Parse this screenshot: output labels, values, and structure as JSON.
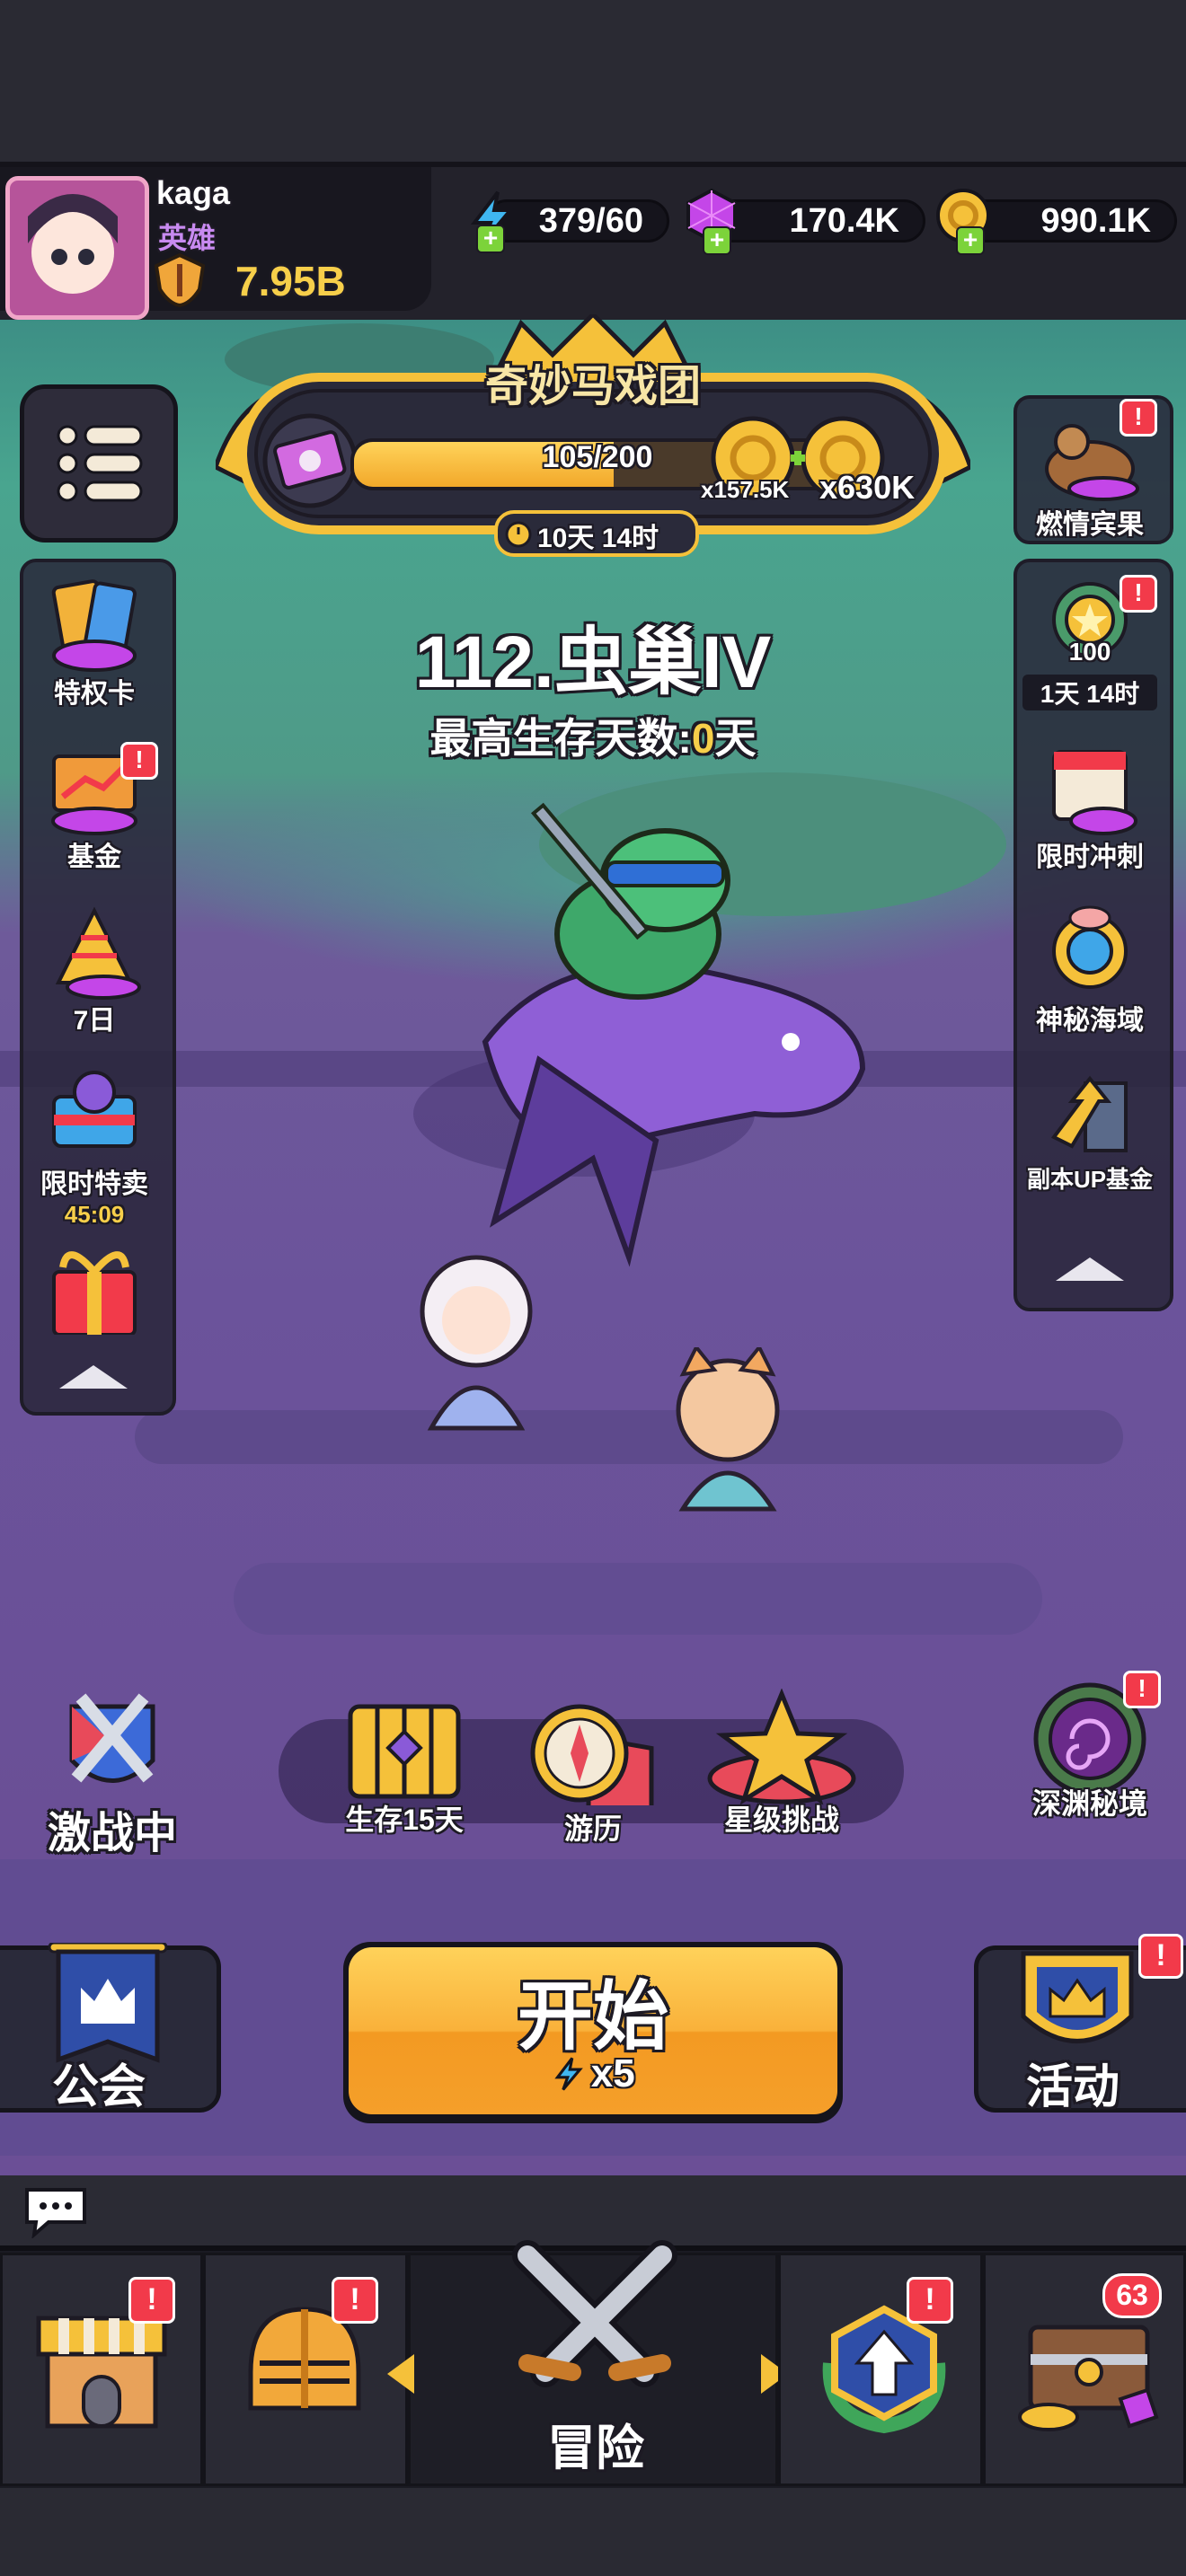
{
  "player": {
    "name": "kaga",
    "title": "英雄",
    "power": "7.95B"
  },
  "resources": {
    "energy": "379/60",
    "gems": "170.4K",
    "coins": "990.1K"
  },
  "event_banner": {
    "title": "奇妙马戏团",
    "progress_text": "105/200",
    "progress_fraction": 0.525,
    "reward_small": "x157.5K",
    "reward_large": "x630K",
    "timer": "10天 14时"
  },
  "stage": {
    "title": "112.虫巢IV",
    "subtitle_prefix": "最高生存天数:",
    "subtitle_value": "0",
    "subtitle_suffix": "天"
  },
  "left_sidebar": [
    {
      "label": "特权卡",
      "icon": "privilege-card-icon",
      "badge": ""
    },
    {
      "label": "基金",
      "icon": "fund-chest-icon",
      "badge": "!"
    },
    {
      "label": "7日",
      "icon": "seven-day-party-icon",
      "badge": ""
    },
    {
      "label": "限时特卖",
      "icon": "limited-sale-icon",
      "badge": "",
      "timer": "45:09"
    },
    {
      "label": "",
      "icon": "gift-box-icon",
      "badge": ""
    }
  ],
  "right_sidebar_top": {
    "label": "燃情宾果",
    "icon": "bingo-icon",
    "badge": "!"
  },
  "right_sidebar": [
    {
      "label": "",
      "icon": "star-medal-icon",
      "badge": "!",
      "count": "100",
      "timer": "1天 14时"
    },
    {
      "label": "限时冲刺",
      "icon": "calendar-sprint-icon",
      "badge": ""
    },
    {
      "label": "神秘海域",
      "icon": "mystic-sea-icon",
      "badge": ""
    },
    {
      "label": "副本UP基金",
      "icon": "dungeon-up-fund-icon",
      "badge": ""
    }
  ],
  "mid_actions": {
    "battle": "激战中",
    "survive": "生存15天",
    "travel": "游历",
    "star_challenge": "星级挑战",
    "abyss": "深渊秘境"
  },
  "main_actions": {
    "guild": "公会",
    "start": "开始",
    "start_cost": "x5",
    "activity": "活动",
    "activity_badge": "!"
  },
  "bottom_nav": {
    "shop_badge": "!",
    "equipment_badge": "!",
    "adventure": "冒险",
    "upgrade_badge": "!",
    "treasure_count": "63"
  },
  "colors": {
    "accent_orange": "#f7a12a",
    "badge_red": "#f23a4a",
    "gold": "#f5c13a",
    "purple_gem": "#c446e8",
    "energy_blue": "#3fb6f0"
  }
}
